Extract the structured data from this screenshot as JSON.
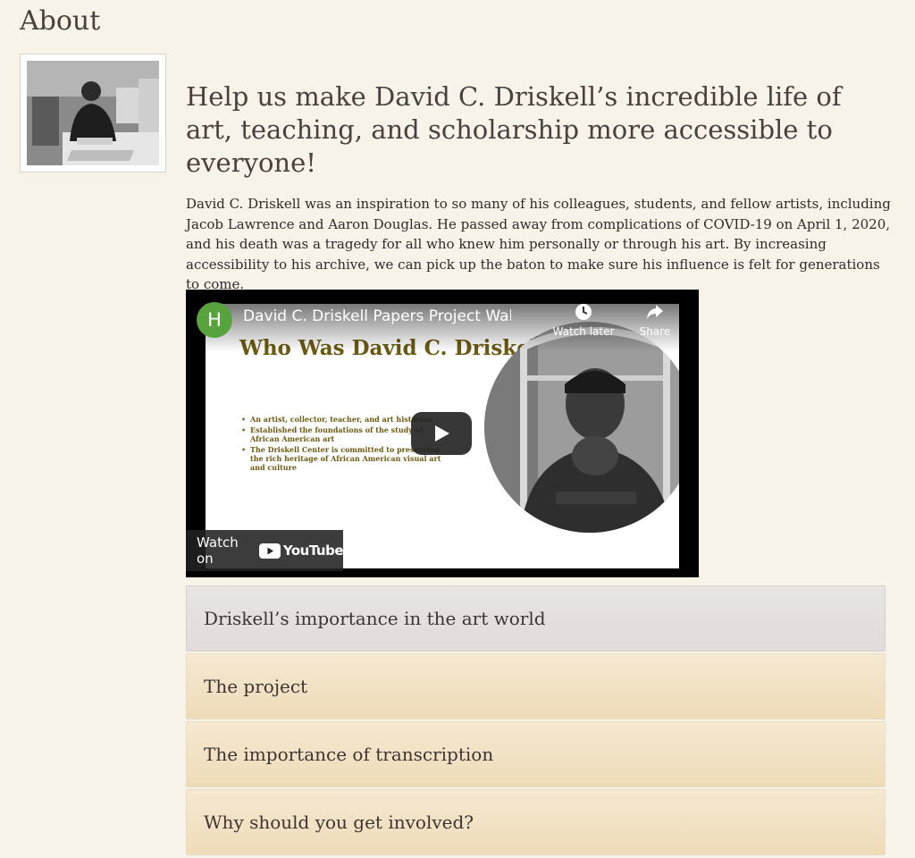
{
  "page": {
    "title": "About",
    "heading": "Help us make David C. Driskell’s incredible life of art, teaching, and scholarship more accessible to everyone!",
    "intro": "David C. Driskell was an inspiration to so many of his colleagues, students, and fellow artists, including Jacob Lawrence and Aaron Douglas. He passed away from complications of COVID-19 on April 1, 2020, and his death was a tragedy for all who knew him personally or through his art. By increasing accessibility to his archive, we can pick up the baton to make sure his influence is felt for generations to come."
  },
  "video": {
    "channel_initial": "H",
    "title": "David C. Driskell Papers Project Walk-th...",
    "watch_later": "Watch later",
    "share": "Share",
    "watch_on": "Watch on",
    "youtube": "YouTube",
    "slide_title": "Who Was David C. Driskell?",
    "slide_bullets": [
      "An artist, collector, teacher, and art historian",
      "Established the foundations of the study of African American art",
      "The Driskell Center is committed to preserving the rich heritage of African American visual art and culture"
    ]
  },
  "accordion": [
    {
      "label": "Driskell’s importance in the art world"
    },
    {
      "label": "The project"
    },
    {
      "label": "The importance of transcription"
    },
    {
      "label": "Why should you get involved?"
    }
  ],
  "colors": {
    "background": "#f8f3e8",
    "accordion_closed": "#f2e3c5",
    "accordion_open": "#e5e0de",
    "channel_avatar": "#58a33e",
    "slide_title": "#6b5a12"
  }
}
